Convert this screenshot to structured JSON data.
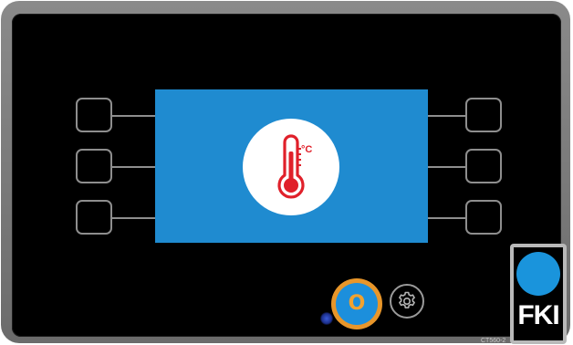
{
  "screen": {
    "background_color": "#1f8bd0",
    "icon": "thermometer-icon",
    "unit_label": "°C",
    "icon_color": "#e0202a"
  },
  "soft_keys": {
    "left": [
      "",
      "",
      ""
    ],
    "right": [
      "",
      "",
      ""
    ]
  },
  "controls": {
    "start_button_label": "O",
    "start_button_ring_color": "#e8962a",
    "start_button_fill_color": "#1c8fdc",
    "settings_icon": "gear-icon",
    "status_led_color": "#2a47c8"
  },
  "brand": {
    "logo_text": "FKI",
    "logo_dot_color": "#1a94dc",
    "model_code": "CT560-2"
  }
}
